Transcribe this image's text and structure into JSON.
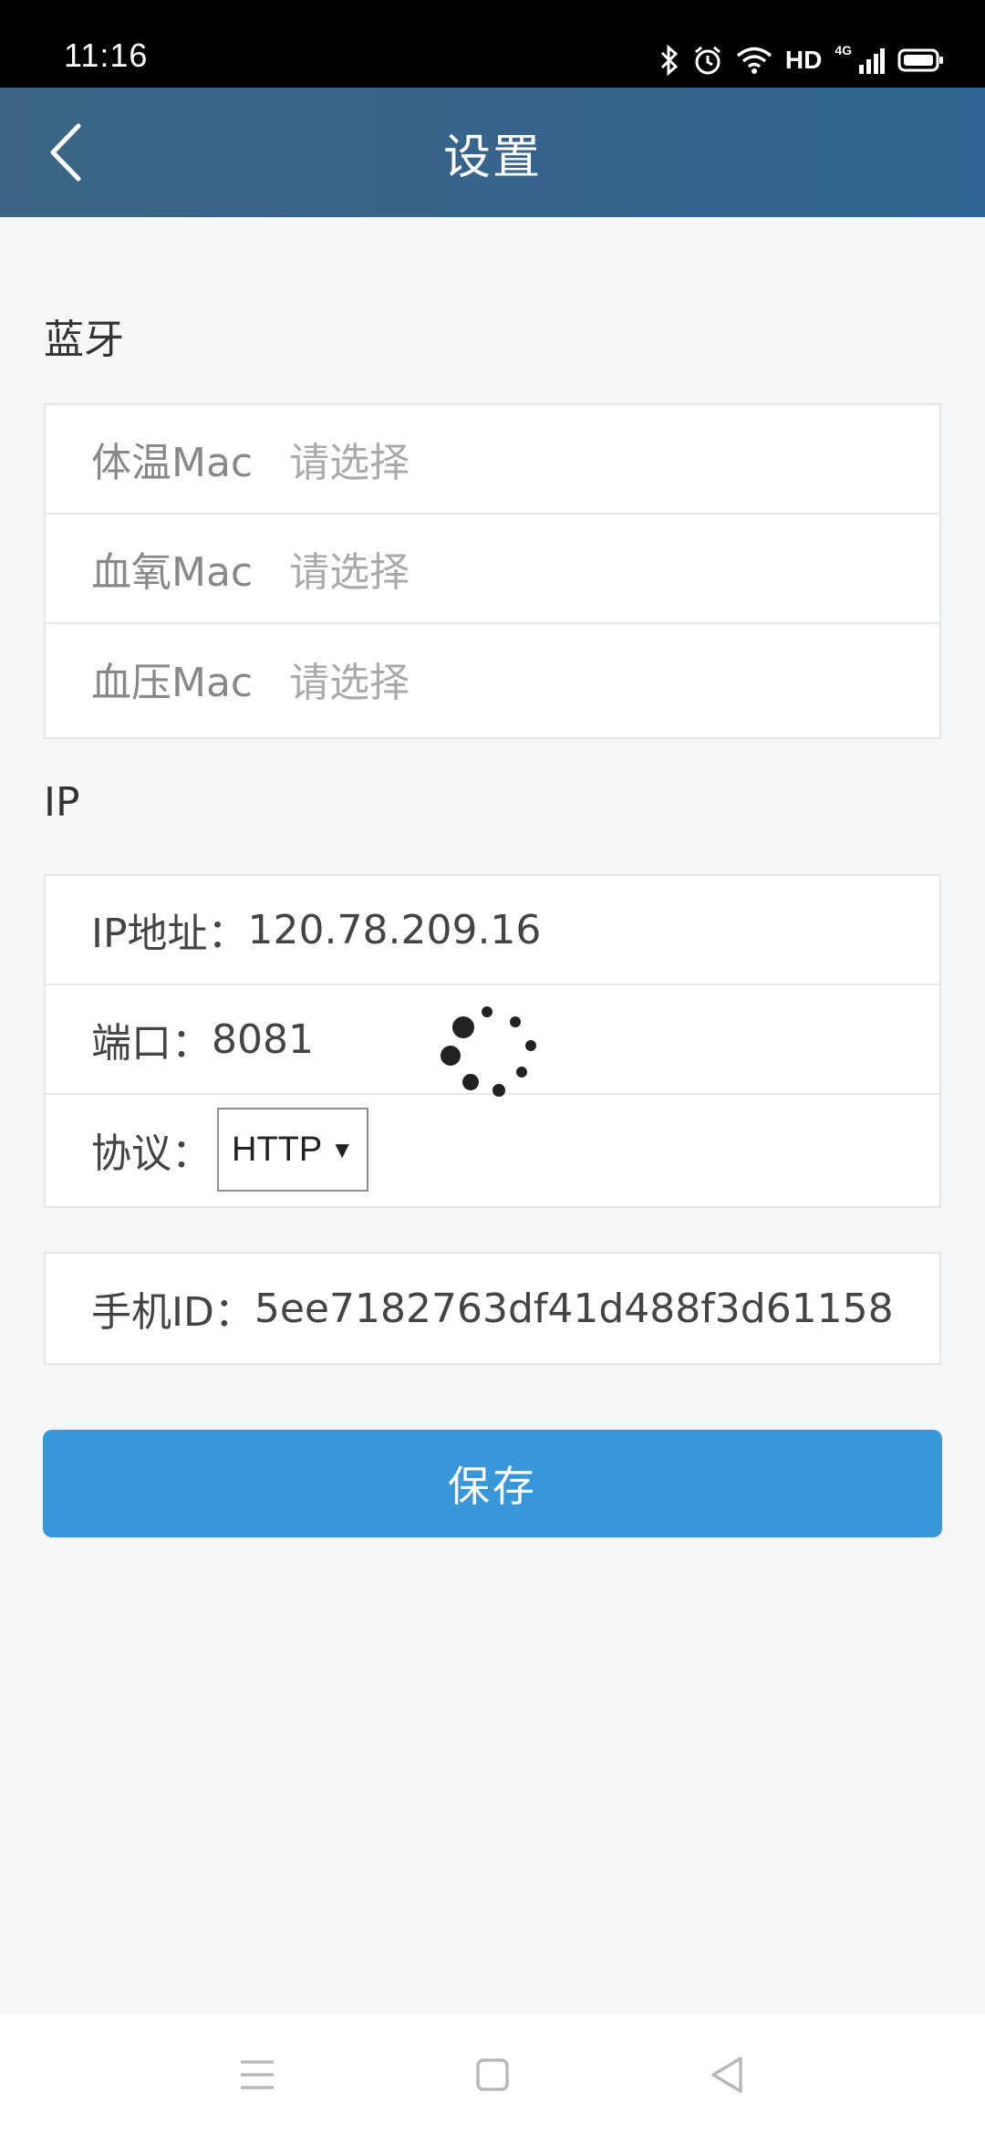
{
  "status_bar": {
    "time": "11:16",
    "hd_label": "HD",
    "network_label": "4G"
  },
  "header": {
    "title": "设置"
  },
  "bluetooth": {
    "section_title": "蓝牙",
    "rows": [
      {
        "label": "体温Mac",
        "placeholder": "请选择"
      },
      {
        "label": "血氧Mac",
        "placeholder": "请选择"
      },
      {
        "label": "血压Mac",
        "placeholder": "请选择"
      }
    ]
  },
  "ip": {
    "section_title": "IP",
    "address_label": "IP地址：",
    "address_value": "120.78.209.16",
    "port_label": "端口：",
    "port_value": "8081",
    "protocol_label": "协议：",
    "protocol_value": "HTTP"
  },
  "phone": {
    "id_label": "手机ID：",
    "id_value": "5ee7182763df41d488f3d61158"
  },
  "save_label": "保存",
  "colors": {
    "header_bg": "#36648a",
    "save_button": "#3897d8"
  }
}
